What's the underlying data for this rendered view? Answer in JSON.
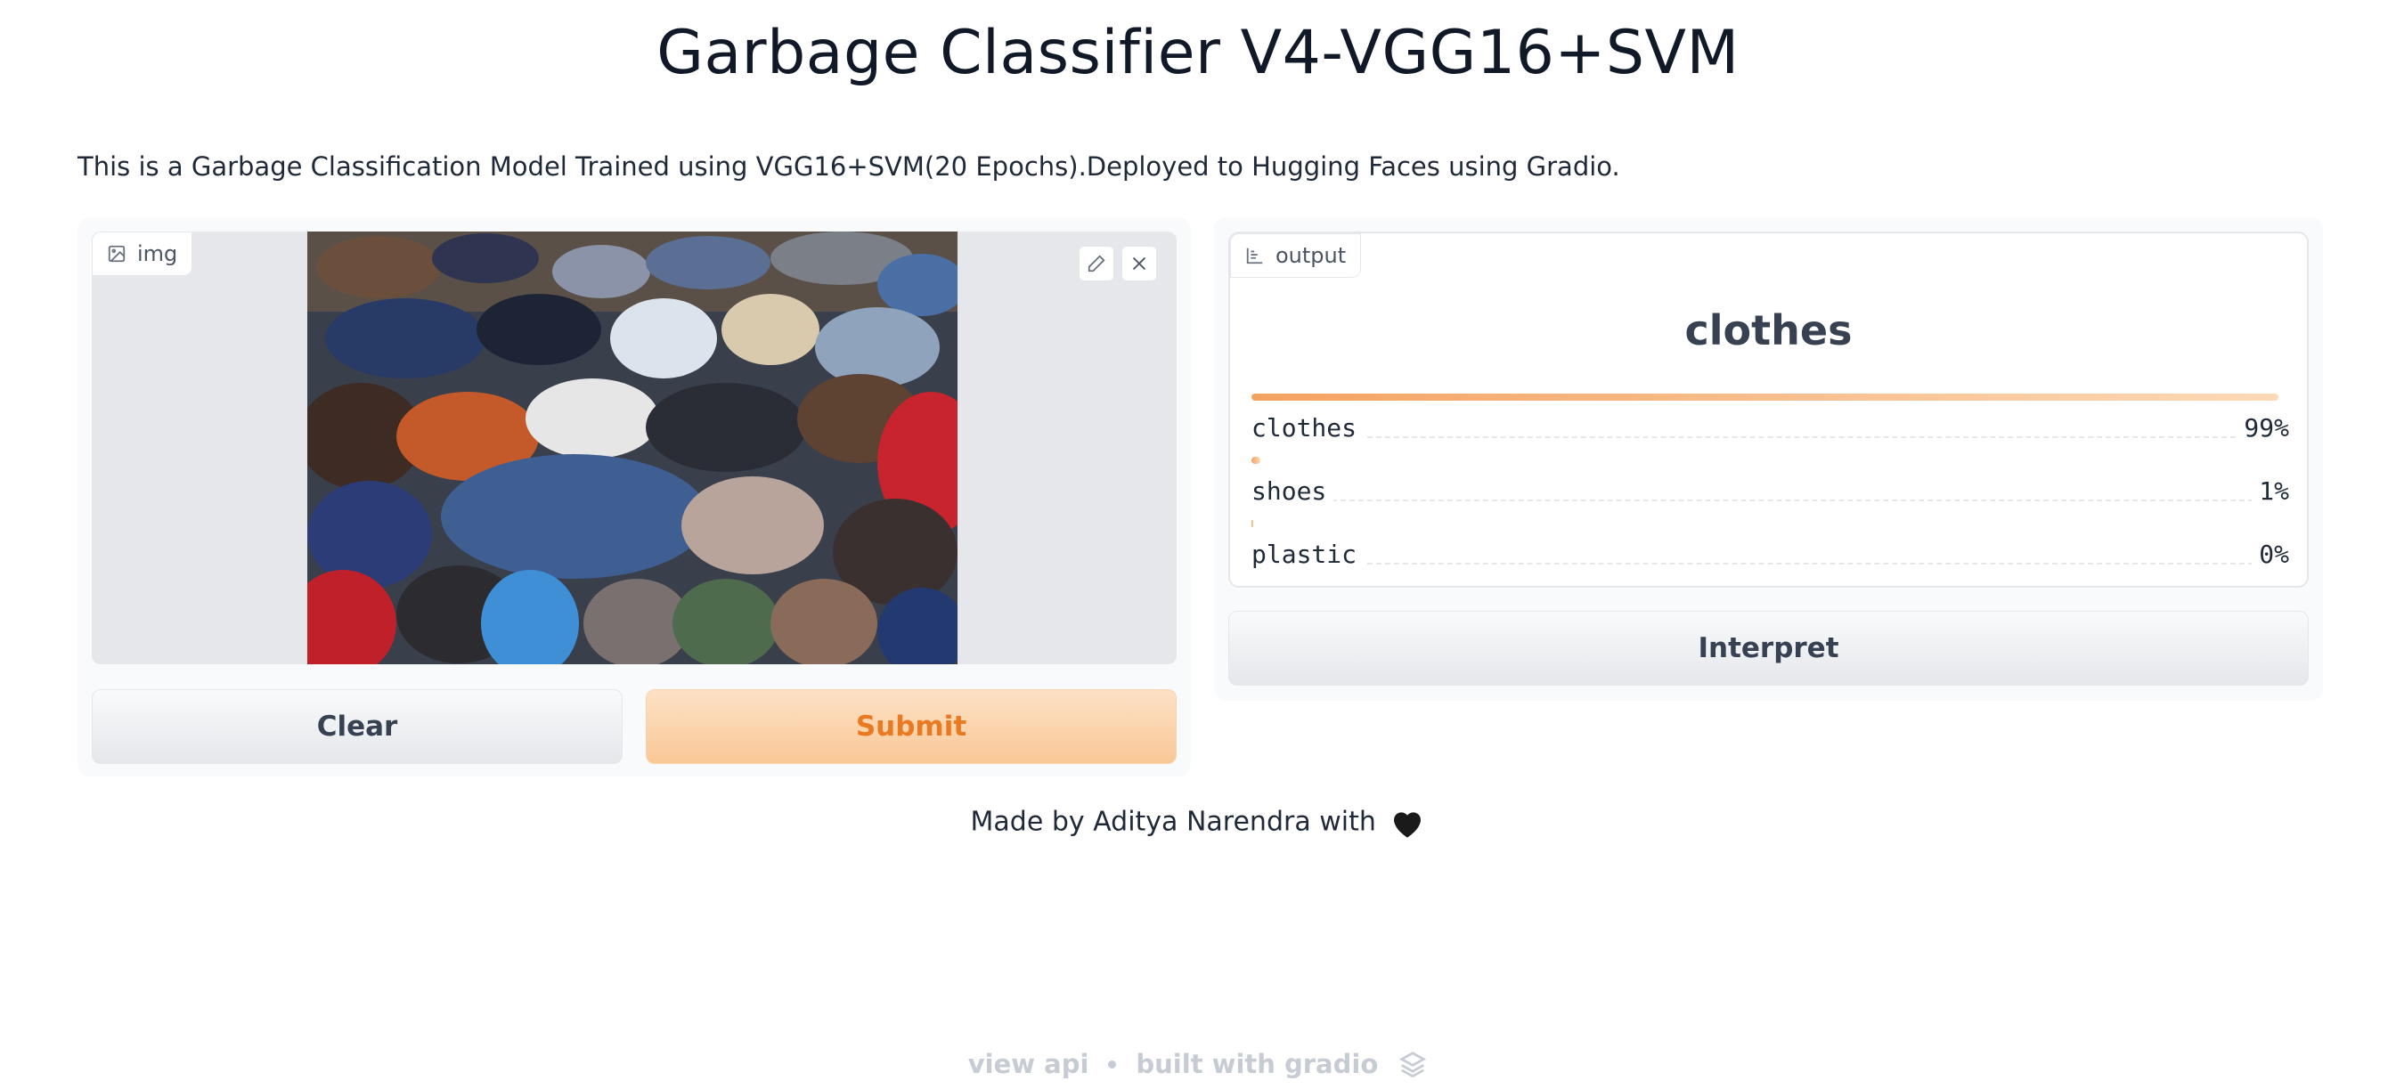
{
  "header": {
    "title": "Garbage Classifier V4-VGG16+SVM",
    "description": "This is a Garbage Classification Model Trained using VGG16+SVM(20 Epochs).Deployed to Hugging Faces using Gradio."
  },
  "input": {
    "label": "img",
    "icon": "image-icon",
    "clear_label": "Clear",
    "submit_label": "Submit"
  },
  "output": {
    "label": "output",
    "icon": "bar-chart-icon",
    "top_label": "clothes",
    "confidences": [
      {
        "label": "clothes",
        "percent": "99%",
        "value": 0.99
      },
      {
        "label": "shoes",
        "percent": "1%",
        "value": 0.01
      },
      {
        "label": "plastic",
        "percent": "0%",
        "value": 0.0
      }
    ],
    "interpret_label": "Interpret"
  },
  "footer": {
    "credit": "Made by Aditya Narendra with",
    "heart": "black-heart-emoji",
    "view_api": "view api",
    "built_with": "built with gradio"
  },
  "colors": {
    "accent": "#f4a261",
    "submit_text": "#ea7a22"
  }
}
